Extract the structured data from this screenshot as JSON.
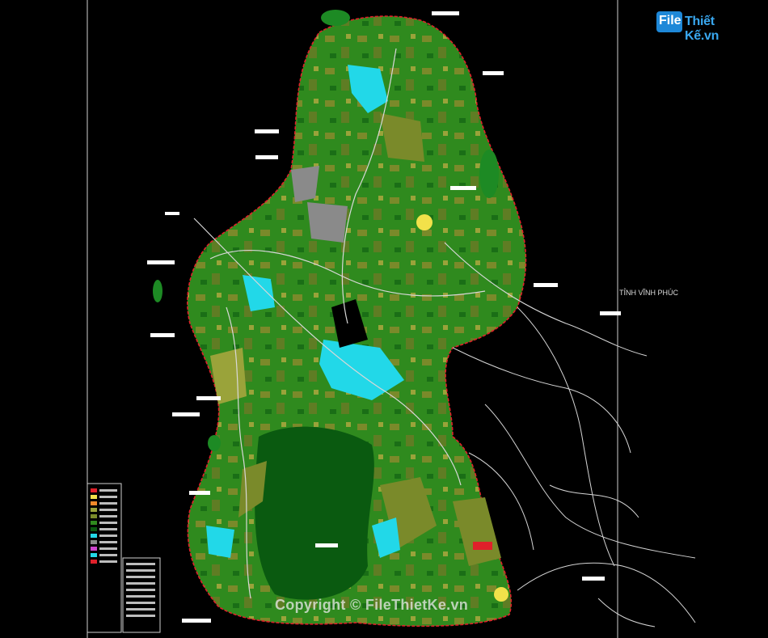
{
  "logo": {
    "file": "File",
    "rest": "Thiết Kế.vn"
  },
  "map": {
    "province_label": "TỈNH VĨNH PHÚC"
  },
  "watermark": "Copyright © FileThietKe.vn",
  "colors": {
    "background": "#000000",
    "boundary": "#e0202a",
    "forest_dark": "#0a5a10",
    "forest": "#2f8a1e",
    "agriculture": "#7a8a2a",
    "water": "#22d8e8",
    "urban": "#f2e14a",
    "built": "#8a8a8a",
    "road": "#d8d8d8"
  },
  "icons": [
    "legend-panel",
    "north-arrow-none"
  ]
}
